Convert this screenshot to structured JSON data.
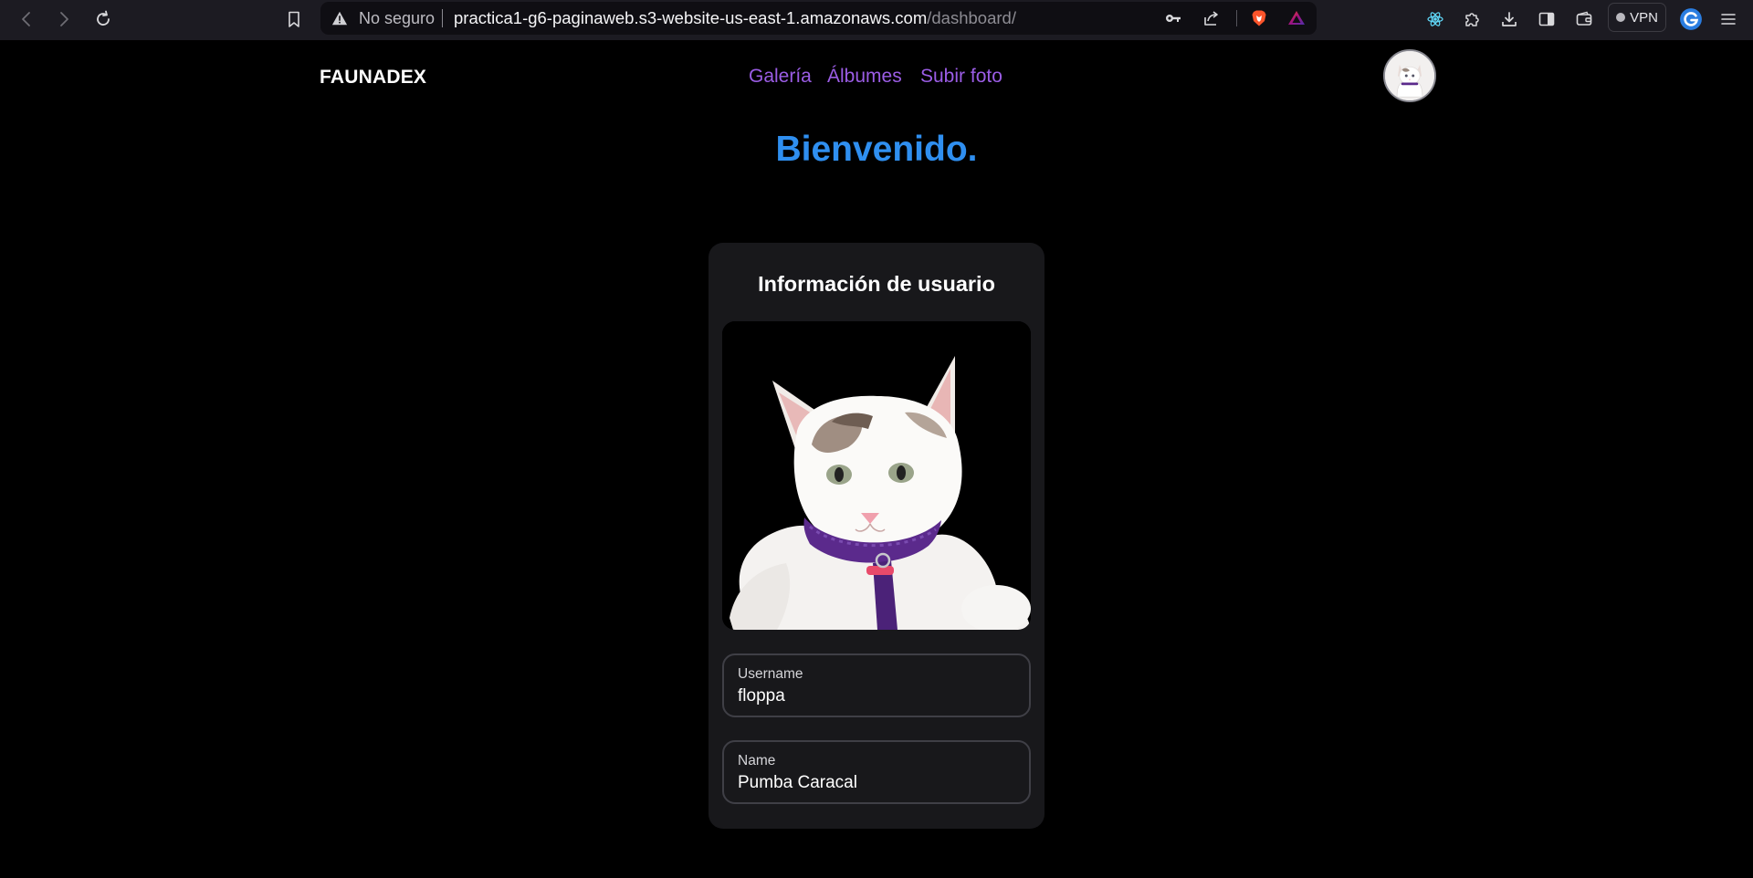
{
  "browser": {
    "security_label": "No seguro",
    "url_host": "practica1-g6-paginaweb.s3-website-us-east-1.amazonaws.com",
    "url_path": "/dashboard/",
    "vpn_label": "VPN"
  },
  "site": {
    "brand": "FAUNADEX",
    "nav": [
      {
        "label": "Galería"
      },
      {
        "label": "Álbumes"
      },
      {
        "label": "Subir foto"
      }
    ],
    "accent_color": "#9b5de5",
    "heading_color": "#2f8ff0"
  },
  "main": {
    "heading": "Bienvenido.",
    "card": {
      "title": "Información de usuario",
      "fields": [
        {
          "label": "Username",
          "value": "floppa"
        },
        {
          "label": "Name",
          "value": "Pumba Caracal"
        }
      ]
    }
  }
}
